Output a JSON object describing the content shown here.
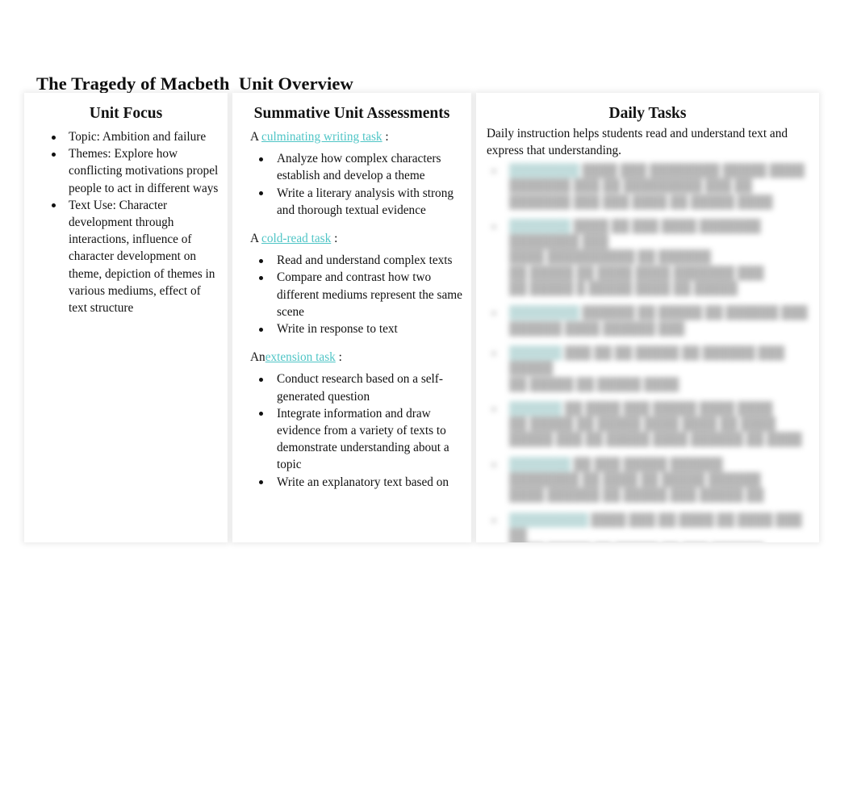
{
  "page": {
    "title": "The Tragedy of Macbeth  Unit Overview",
    "background_color": "#ffffff",
    "link_color": "#4fc5c6",
    "highlight_color": "#cdeded"
  },
  "columns": {
    "unit_focus": {
      "title": "Unit Focus",
      "bullets": [
        "Topic: Ambition and failure",
        "Themes:  Explore how conflicting motivations propel people to act in different ways",
        "Text Use: Character development through interactions, influence of character development on theme, depiction of themes in various mediums, effect of text structure"
      ]
    },
    "summative_unit_assessments": {
      "title": "Summative Unit Assessments",
      "sections": [
        {
          "lead_prefix": "A ",
          "lead_link": "culminating writing task",
          "lead_suffix": " :",
          "bullets": [
            "Analyze how complex characters establish and develop a theme",
            "Write a literary analysis with strong and thorough textual evidence"
          ]
        },
        {
          "lead_prefix": "A ",
          "lead_link": "cold-read task",
          "lead_suffix": " :",
          "bullets": [
            "Read and understand complex texts",
            "Compare and contrast how two different mediums represent the same scene",
            "Write in response to text"
          ]
        },
        {
          "lead_prefix": "An",
          "lead_link": "extension task",
          "lead_suffix": " :",
          "bullets": [
            "Conduct research based on a self-generated question",
            "Integrate information and draw evidence from a variety of texts to demonstrate understanding about a topic",
            "Write an explanatory text based on"
          ]
        }
      ]
    },
    "daily_tasks": {
      "title": "Daily Tasks",
      "intro": "Daily instruction helps students read and understand text and express that understanding.",
      "obscured": true,
      "rows": [
        {
          "label": "████████",
          "text": " ████ ███ ████████ █████ ████\n███████ ███ ██ █████████ ███ ██\n███████ ███ ███ ████ ██ █████ ████"
        },
        {
          "label": "███████",
          "text": " ████ ██ ███ ████ ███████ ████████ ███\n████ ██████████ ██ ██████\n██ █████ ██ ████ ████ ███████ ███\n██ █████ █ █████ ████ ██ █████"
        },
        {
          "label": "████████",
          "text": " ██████ ██ █████ ██ ██████ ███\n██████ ████ ██████ ███"
        },
        {
          "label": "██████",
          "text": " ███ ██ ██ █████ ██ ██████ ███ █████\n██ █████ ██ █████ ████"
        },
        {
          "label": "██████",
          "text": " ██ ████ ███ █████ ████ ████\n██ █████ ██ █████ ████ ████ ██ ████\n█████ ███ ██ █████ ████ ██████ ██ ████"
        },
        {
          "label": "███████",
          "text": " ██ ███ █████ ██████\n████████ ██ ████ ██ █████ ██████\n████ ██████ ██ █████ ███ █████ ██"
        },
        {
          "label": "█████████",
          "text": " ████ ███ ██ ████ ██ ████ ███ ██\n████ █████ ██ █████ ██ ███ ██████\n████ █████ █ ████ ███ ███████"
        },
        {
          "label": "████████",
          "text": " ████ ████ ███ ███████ ████\n██████ ████████ ███"
        }
      ]
    }
  }
}
